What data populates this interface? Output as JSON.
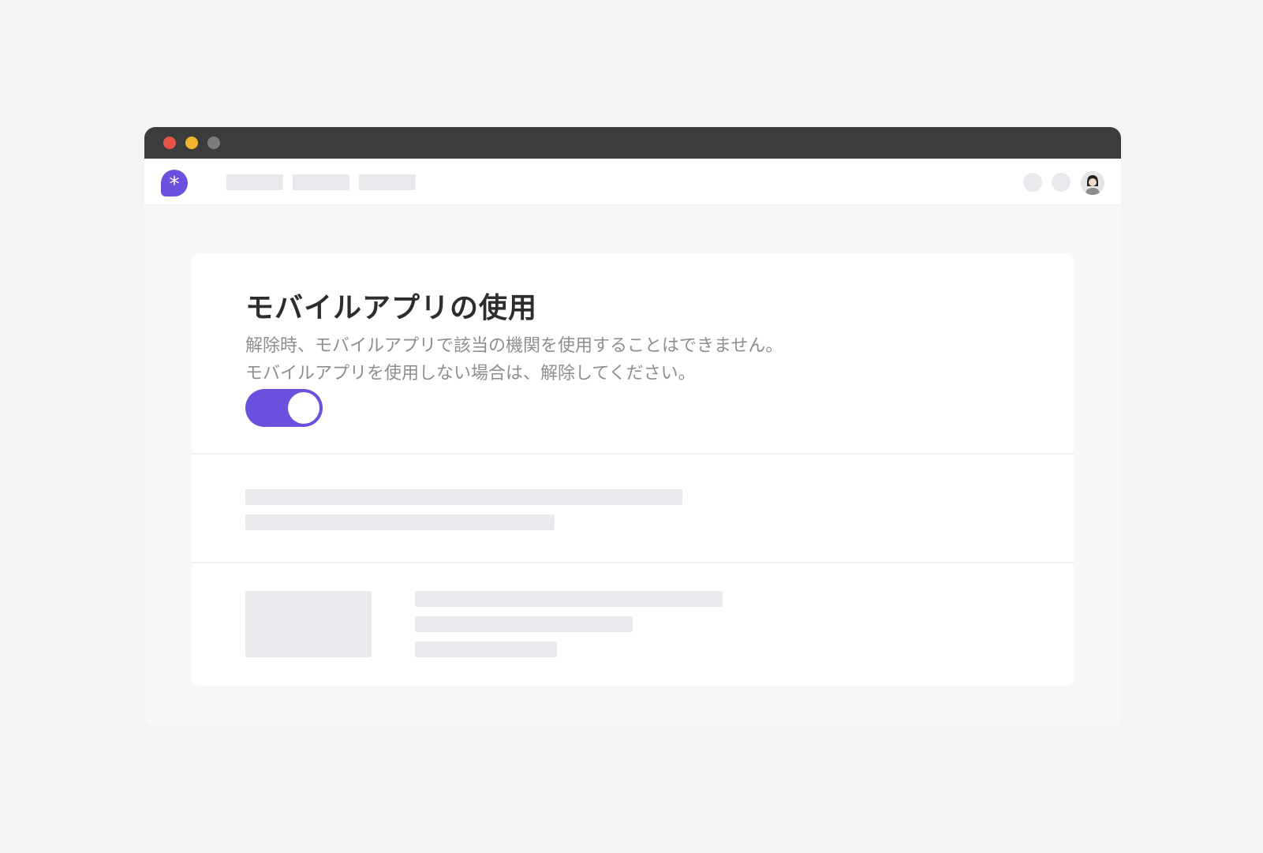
{
  "window": {
    "traffic_lights": {
      "close": "#e5534b",
      "minimize": "#f2b530",
      "zoom": "#7d7d7d"
    }
  },
  "appbar": {
    "logo_icon": "asterisk-icon",
    "logo_glyph": "*",
    "accent_color": "#6b4fdd",
    "avatar_icon": "user-avatar-icon"
  },
  "setting": {
    "title": "モバイルアプリの使用",
    "description_line1": "解除時、モバイルアプリで該当の機関を使用することはできません。",
    "description_line2": "モバイルアプリを使用しない場合は、解除してください。",
    "toggle_on": true
  }
}
